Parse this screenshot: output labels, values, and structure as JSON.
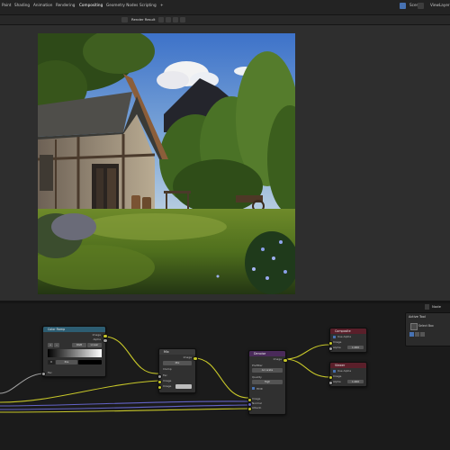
{
  "topbar": {
    "tabs": [
      "Paint",
      "Shading",
      "Animation",
      "Rendering",
      "Compositing",
      "Geometry Nodes",
      "Scripting",
      "+"
    ],
    "active_tab": "Compositing",
    "scene_label": "Scene",
    "view_layer_label": "ViewLayer"
  },
  "image_header": {
    "image_name": "Render Result"
  },
  "side_panel": {
    "tab_label": "Node",
    "title": "Active Tool",
    "tool_label": "Select Box"
  },
  "nodes": {
    "color_ramp": {
      "title": "Color Ramp",
      "out_image": "Image",
      "out_alpha": "Alpha",
      "mode": "RGB",
      "interp": "Linear",
      "pos": "Pos",
      "in_fac": "Fac"
    },
    "mix": {
      "title": "Mix",
      "out_image": "Image",
      "blend": "Mix",
      "clamp": "Clamp",
      "in_fac": "Fac",
      "in_image_a": "Image",
      "in_image_b": "Image"
    },
    "denoise": {
      "title": "Denoise",
      "out_image": "Image",
      "prefilter_label": "Prefilter",
      "prefilter_value": "Accurate",
      "quality_label": "Quality",
      "quality_value": "High",
      "hdr_label": "HDR",
      "in_image": "Image",
      "in_normal": "Normal",
      "in_albedo": "Albedo"
    },
    "composite": {
      "title": "Composite",
      "use_alpha": "Use Alpha",
      "in_image": "Image",
      "in_alpha": "Alpha",
      "alpha_value": "1.000"
    },
    "viewer": {
      "title": "Viewer",
      "use_alpha": "Use Alpha",
      "in_image": "Image",
      "in_alpha": "Alpha",
      "alpha_value": "1.000"
    }
  },
  "colors": {
    "socket_color": "#c7c729",
    "socket_vector": "#6363c7",
    "header_converter": "#2d5d72",
    "header_color": "#3a3a3a",
    "header_filter": "#4a2a5a",
    "header_output": "#5a1f2a"
  }
}
